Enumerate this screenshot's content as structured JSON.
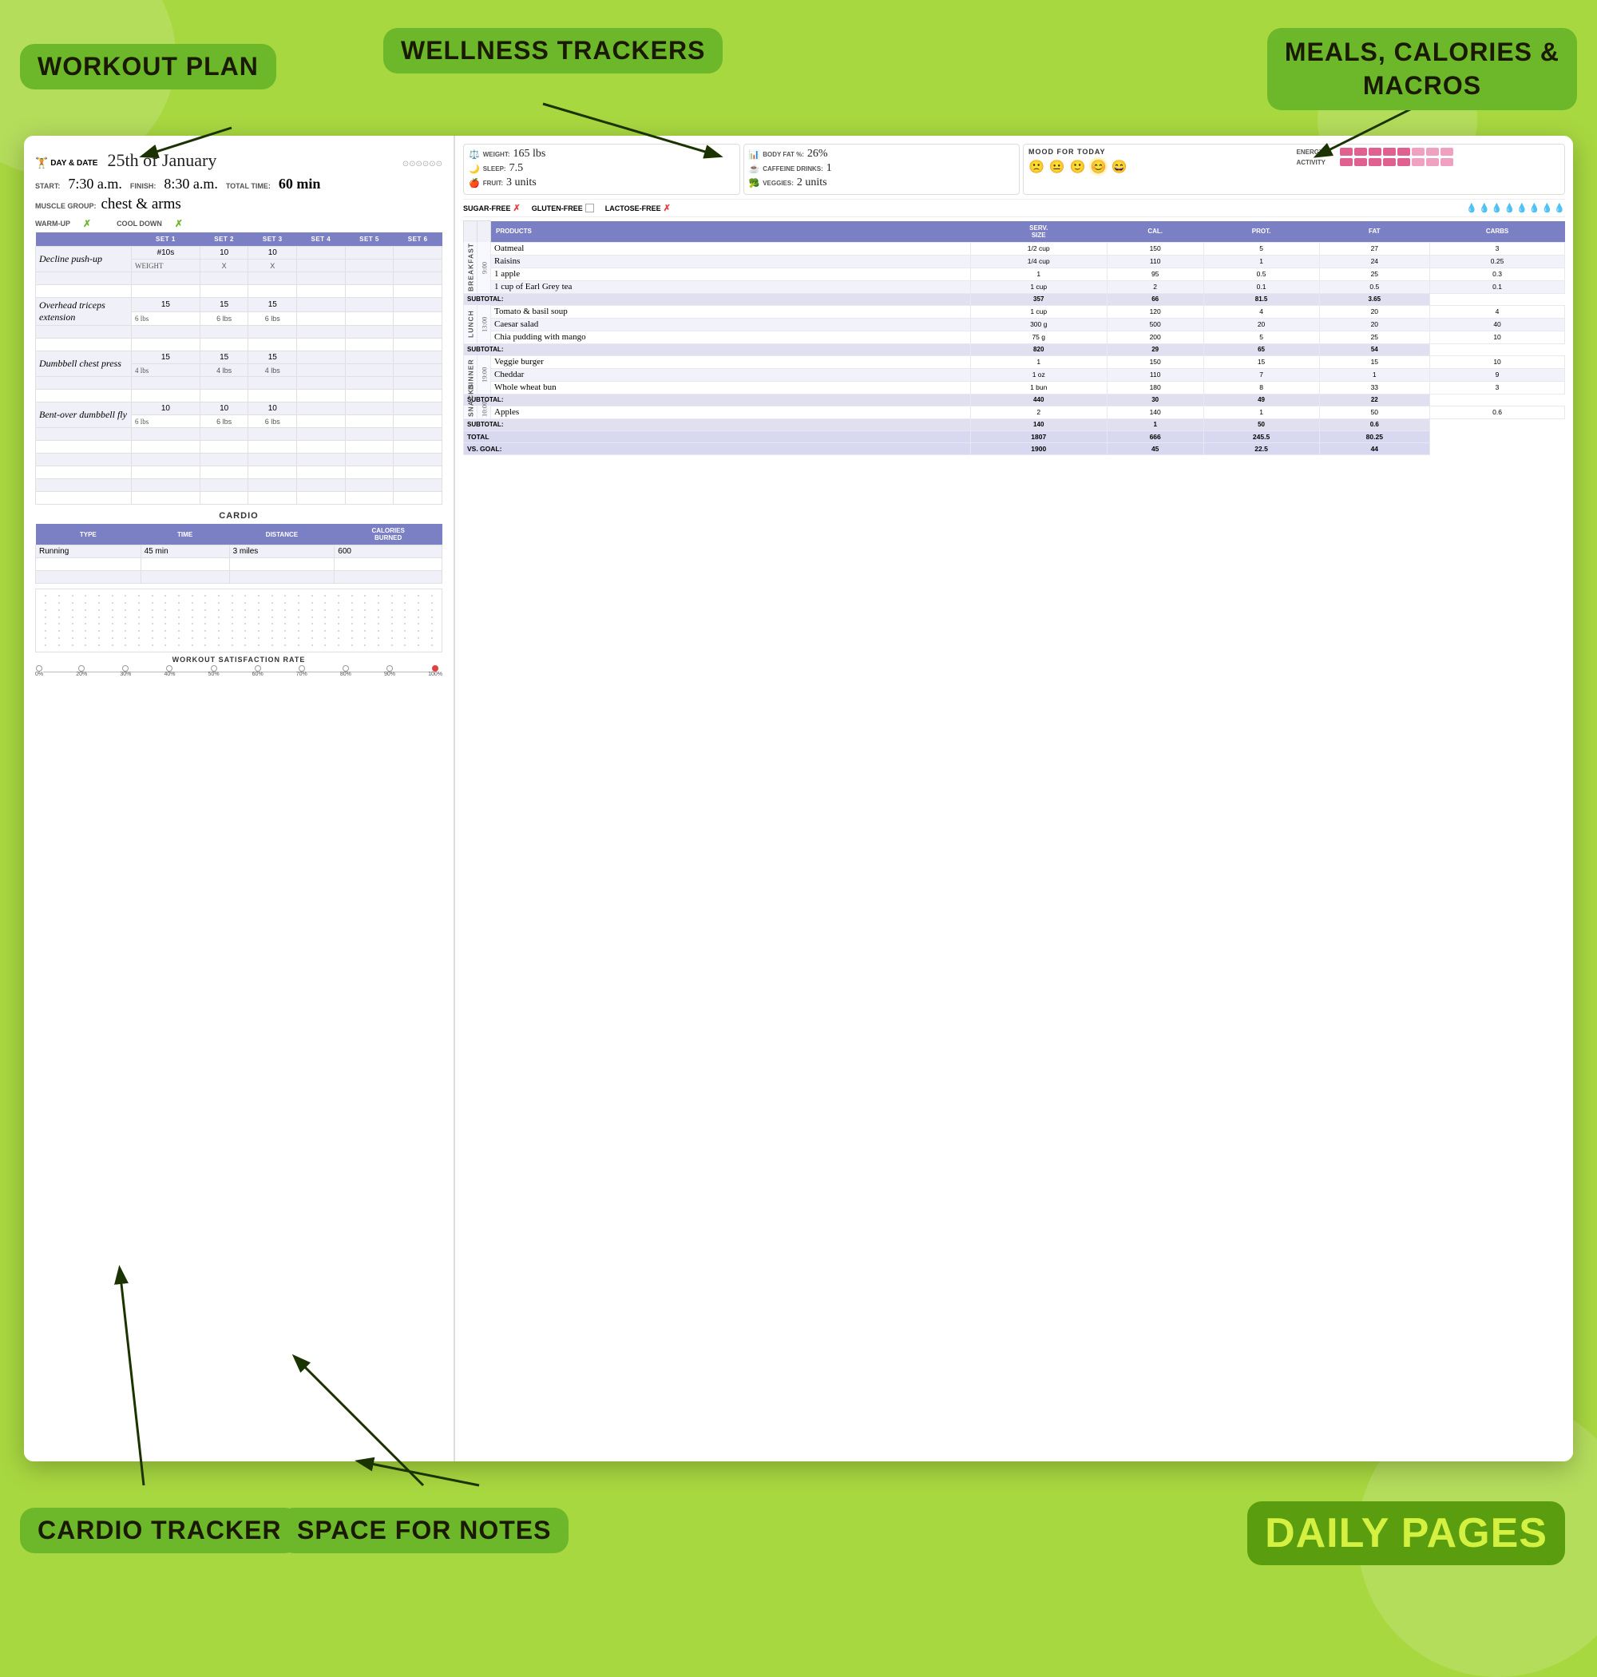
{
  "page": {
    "title": "Daily Pages",
    "bg_color": "#a8d840"
  },
  "labels": {
    "workout_plan": "WORKOUT PLAN",
    "wellness_trackers": "WELLNESS TRACKERS",
    "meals_calories": "MEALS, CALORIES &\nMACROS",
    "cardio_tracker": "CARDIO TRACKER",
    "space_for_notes": "SPACE FOR NOTES",
    "daily_pages": "DAILY PAGES"
  },
  "left_page": {
    "day_label": "DAY & DATE",
    "day_value": "25th of January",
    "start_label": "START:",
    "start_value": "7:30 a.m.",
    "finish_label": "FINISH:",
    "finish_value": "8:30 a.m.",
    "total_time_label": "TOTAL TIME:",
    "total_time_value": "60 min",
    "muscle_group_label": "MUSCLE GROUP:",
    "muscle_group_value": "chest & arms",
    "warmup_label": "WARM-UP",
    "cool_down_label": "COOL DOWN",
    "set_headers": [
      "SET 1",
      "SET 2",
      "SET 3",
      "SET 4",
      "SET 5",
      "SET 6"
    ],
    "exercises": [
      {
        "name": "Decline push-up",
        "sets": [
          "#10s",
          "10",
          "10",
          "",
          "",
          ""
        ],
        "weights": [
          "WEIGHT",
          "X",
          "X",
          "",
          "",
          ""
        ]
      },
      {
        "name": "Overhead triceps extension",
        "sets": [
          "15",
          "15",
          "15",
          "",
          "",
          ""
        ],
        "weights": [
          "6 lbs",
          "6 lbs",
          "6 lbs",
          "",
          "",
          ""
        ]
      },
      {
        "name": "Dumbbell chest press",
        "sets": [
          "15",
          "15",
          "15",
          "",
          "",
          ""
        ],
        "weights": [
          "4 lbs",
          "4 lbs",
          "4 lbs",
          "",
          "",
          ""
        ]
      },
      {
        "name": "Bent-over dumbbell fly",
        "sets": [
          "10",
          "10",
          "10",
          "",
          "",
          ""
        ],
        "weights": [
          "6 lbs",
          "6 lbs",
          "6 lbs",
          "",
          "",
          ""
        ]
      }
    ],
    "cardio": {
      "header": "CARDIO",
      "col_headers": [
        "TYPE",
        "TIME",
        "DISTANCE",
        "CALORIES BURNED"
      ],
      "rows": [
        [
          "Running",
          "45 min",
          "3 miles",
          "600"
        ]
      ]
    },
    "satisfaction": {
      "label": "WORKOUT SATISFACTION RATE",
      "ticks": [
        "0%",
        "20%",
        "30%",
        "40%",
        "50%",
        "60%",
        "70%",
        "80%",
        "90%",
        "100%"
      ],
      "marked_index": 9
    }
  },
  "right_page": {
    "wellness": {
      "weight_label": "WEIGHT:",
      "weight_value": "165 lbs",
      "body_fat_label": "BODY FAT %:",
      "body_fat_value": "26%",
      "sleep_label": "SLEEP:",
      "sleep_value": "7.5",
      "caffeine_label": "CAFFEINE DRINKS:",
      "caffeine_value": "1",
      "fruit_label": "FRUIT:",
      "fruit_value": "3 units",
      "veggies_label": "VEGGIES:",
      "veggies_value": "2 units"
    },
    "mood": {
      "title": "MOOD FOR TODAY",
      "faces": [
        "🙁",
        "😐",
        "🙂",
        "😊",
        "😄"
      ],
      "selected": 3
    },
    "energy": {
      "label": "ENERGY",
      "blocks": 8,
      "filled": 5
    },
    "activity": {
      "label": "ACTIVITY",
      "blocks": 8,
      "filled": 5
    },
    "diet": {
      "sugar_free": "SUGAR-FREE",
      "gluten_free": "GLUTEN-FREE",
      "lactose_free": "LACTOSE-FREE",
      "sugar_checked": false,
      "gluten_checked": true,
      "lactose_checked": false,
      "water_drops": 8,
      "water_filled": 5
    },
    "table": {
      "headers": [
        "PRODUCTS",
        "SERV. SIZE",
        "CAL.",
        "PROT.",
        "FAT",
        "CARBS"
      ],
      "meals": [
        {
          "meal_label": "BREAKFAST",
          "time": "9:00",
          "rows": [
            [
              "Oatmeal",
              "1/2 cup",
              "150",
              "5",
              "27",
              "3"
            ],
            [
              "Raisins",
              "1/4 cup",
              "110",
              "1",
              "24",
              "0.25"
            ],
            [
              "1 apple",
              "1",
              "95",
              "0.5",
              "25",
              "0.3"
            ],
            [
              "1 cup of Earl Grey tea",
              "1 cup",
              "2",
              "0.1",
              "0.5",
              "0.1"
            ]
          ],
          "subtotal": [
            "357",
            "66",
            "81.5",
            "3.65"
          ]
        },
        {
          "meal_label": "LUNCH",
          "time": "13:00",
          "rows": [
            [
              "Tomato & basil soup",
              "1 cup",
              "120",
              "4",
              "20",
              "4"
            ],
            [
              "Caesar salad",
              "300 g",
              "500",
              "20",
              "20",
              "40"
            ],
            [
              "Chia pudding with mango",
              "75 g",
              "200",
              "5",
              "25",
              "10"
            ]
          ],
          "subtotal": [
            "820",
            "29",
            "65",
            "54"
          ]
        },
        {
          "meal_label": "DINNER",
          "time": "19:00",
          "rows": [
            [
              "Veggie burger",
              "1",
              "150",
              "15",
              "15",
              "10"
            ],
            [
              "Cheddar",
              "1 oz",
              "110",
              "7",
              "1",
              "9"
            ],
            [
              "Whole wheat bun",
              "1 bun",
              "180",
              "8",
              "33",
              "3"
            ]
          ],
          "subtotal": [
            "440",
            "30",
            "49",
            "22"
          ]
        },
        {
          "meal_label": "SNACKS",
          "time": "10:00",
          "rows": [
            [
              "Apples",
              "2",
              "140",
              "1",
              "50",
              "0.6"
            ]
          ],
          "subtotal": [
            "140",
            "1",
            "50",
            "0.6"
          ]
        }
      ],
      "total": [
        "1807",
        "666",
        "245.5",
        "80.25"
      ],
      "vs_goal": [
        "1900",
        "45",
        "22.5",
        "44"
      ]
    }
  }
}
